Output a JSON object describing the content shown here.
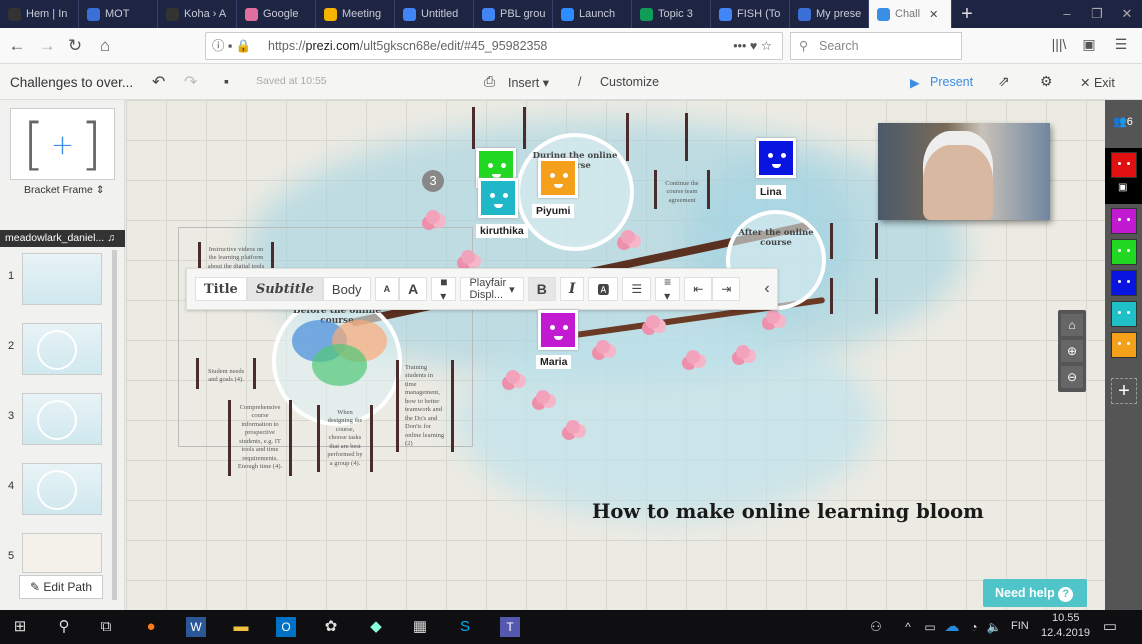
{
  "browser": {
    "tabs": [
      {
        "label": "Hem | In",
        "color": "#333"
      },
      {
        "label": "MOT",
        "color": "#3a6fd8"
      },
      {
        "label": "Koha › A",
        "color": "#333"
      },
      {
        "label": "Google",
        "color": "#e06fa0"
      },
      {
        "label": "Meeting",
        "color": "#f4b400"
      },
      {
        "label": "Untitled",
        "color": "#4285f4"
      },
      {
        "label": "PBL grou",
        "color": "#4285f4"
      },
      {
        "label": "Launch",
        "color": "#2d8cff"
      },
      {
        "label": "Topic 3",
        "color": "#0f9d58"
      },
      {
        "label": "FISH (To",
        "color": "#4285f4"
      },
      {
        "label": "My prese",
        "color": "#3a6fd8"
      },
      {
        "label": "Chall",
        "color": "#3a8ee6",
        "active": true
      }
    ],
    "url_prefix": "https://",
    "url_domain": "prezi.com",
    "url_path": "/ult5gkscn68e/edit/#45_95982358",
    "search_placeholder": "Search"
  },
  "prezi": {
    "title": "Challenges to over...",
    "saved": "Saved at 10:55",
    "insert": "Insert",
    "customize": "Customize",
    "present": "Present",
    "exit": "Exit",
    "accent": "#3a8ee6"
  },
  "sidebar": {
    "frame_label": "Bracket Frame",
    "user_tag": "meadowlark_daniel...",
    "slides": [
      "1",
      "2",
      "3",
      "4",
      "5"
    ],
    "edit_path": "Edit Path"
  },
  "text_toolbar": {
    "title": "Title",
    "subtitle": "Subtitle",
    "body": "Body",
    "font": "Playfair Displ...",
    "bold": "B",
    "italic": "I"
  },
  "canvas": {
    "main_title": "How to make online learning bloom",
    "step_badge": "3",
    "during": "During the online course",
    "before": "Before the online course",
    "after": "After the online course",
    "notes": [
      "Instructive videos on the learning platform about the digital tools",
      "Student needs and goals (4).",
      "Comprehensive course information to prospective students, e.g. IT tools and time requirements. Enough time (4).",
      "When designing the course, choose tasks that are best performed by a group (4).",
      "Training students in time management, how to better teamwork and the Do's and Don'ts for online learning (2)",
      "Continue the course team agreement"
    ],
    "collaborators": [
      {
        "name": "kiruthika",
        "color": "#20b8c8"
      },
      {
        "name": "Piyumi",
        "color": "#f4a01a"
      },
      {
        "name": "Lina",
        "color": "#0a14e0"
      },
      {
        "name": "Maria",
        "color": "#c21ad0"
      },
      {
        "name": "",
        "color": "#22d822"
      }
    ]
  },
  "right_panel": {
    "participants": "6",
    "avatars": [
      "#e01010",
      "#c21ad0",
      "#22d822",
      "#0a14e0",
      "#20c0c8",
      "#f4a01a"
    ]
  },
  "need_help": "Need help",
  "taskbar": {
    "lang": "FIN",
    "time": "10.55",
    "date": "12.4.2019"
  }
}
